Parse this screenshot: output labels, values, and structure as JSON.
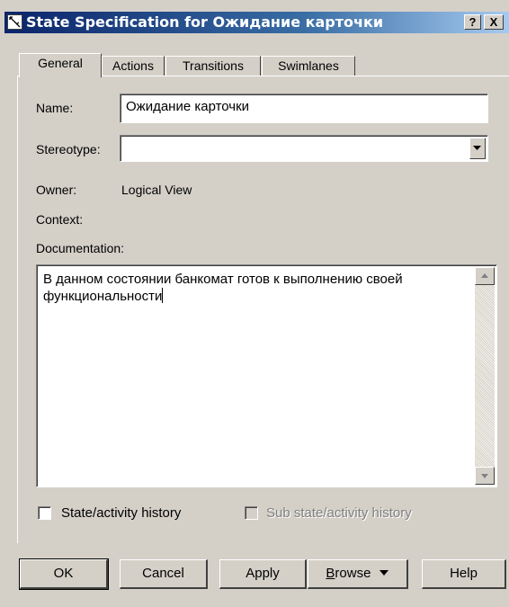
{
  "window": {
    "title": "State Specification for Ожидание карточки",
    "help_button": "?",
    "close_button": "X"
  },
  "tabs": [
    {
      "label": "General",
      "active": true
    },
    {
      "label": "Actions",
      "active": false
    },
    {
      "label": "Transitions",
      "active": false
    },
    {
      "label": "Swimlanes",
      "active": false
    }
  ],
  "general": {
    "name_label": "Name:",
    "name_value": "Ожидание карточки",
    "stereotype_label": "Stereotype:",
    "stereotype_value": "",
    "owner_label": "Owner:",
    "owner_value": "Logical View",
    "context_label": "Context:",
    "documentation_label": "Documentation:",
    "documentation_value": "В данном состоянии банкомат готов к выполнению своей функциональности",
    "state_history_label": "State/activity history",
    "state_history_checked": false,
    "sub_state_history_label": "Sub state/activity history",
    "sub_state_history_checked": false,
    "sub_state_history_enabled": false
  },
  "buttons": {
    "ok": "OK",
    "cancel": "Cancel",
    "apply": "Apply",
    "browse_mnemonic": "B",
    "browse_rest": "rowse",
    "help": "Help"
  },
  "icons": {
    "app": "state-spec-icon",
    "dropdown": "chevron-down-icon",
    "scroll_up": "scroll-up-arrow-icon",
    "scroll_down": "scroll-down-arrow-icon"
  },
  "colors": {
    "titlebar_start": "#0a246a",
    "titlebar_end": "#a6caf0",
    "face": "#d4d0c8"
  }
}
